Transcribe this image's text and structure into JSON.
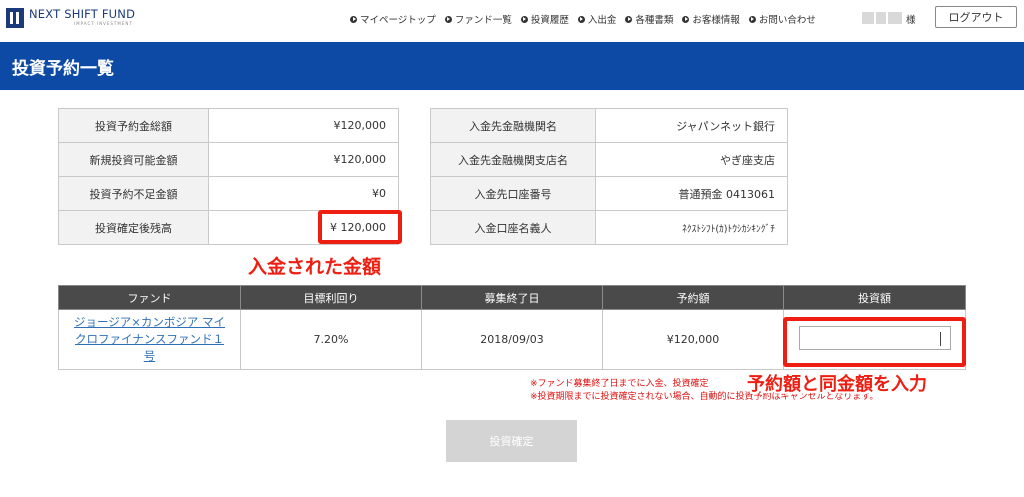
{
  "header": {
    "logo_name": "NEXT SHIFT FUND",
    "logo_sub": "IMPACT INVESTMENT",
    "nav": [
      {
        "label": "マイページトップ"
      },
      {
        "label": "ファンド一覧"
      },
      {
        "label": "投資履歴"
      },
      {
        "label": "入出金"
      },
      {
        "label": "各種書類"
      },
      {
        "label": "お客様情報"
      },
      {
        "label": "お問い合わせ"
      }
    ],
    "user_suffix": "様",
    "logout_label": "ログアウト"
  },
  "page": {
    "title": "投資予約一覧"
  },
  "summary": [
    {
      "label": "投資予約金総額",
      "value": "¥120,000"
    },
    {
      "label": "新規投資可能金額",
      "value": "¥120,000"
    },
    {
      "label": "投資予約不足金額",
      "value": "¥0"
    },
    {
      "label": "投資確定後残高",
      "value": "¥ 120,000"
    }
  ],
  "bank": [
    {
      "label": "入金先金融機関名",
      "value": "ジャパンネット銀行"
    },
    {
      "label": "入金先金融機関支店名",
      "value": "やぎ座支店"
    },
    {
      "label": "入金先口座番号",
      "value": "普通預金 0413061"
    },
    {
      "label": "入金口座名義人",
      "value": "ﾈｸｽﾄｼﾌﾄ(ｶ)ﾄｳｼｶｼｷﾝｸﾞﾁ"
    }
  ],
  "fund_table": {
    "headers": [
      "ファンド",
      "目標利回り",
      "募集終了日",
      "予約額",
      "投資額"
    ],
    "rows": [
      {
        "fund_name": "ジョージア×カンボジア マイクロファイナンスファンド１号",
        "yield": "7.20%",
        "end_date": "2018/09/03",
        "reserved": "¥120,000",
        "invest_value": ""
      }
    ]
  },
  "annotations": {
    "deposit": "入金された金額",
    "invest": "予約額と同金額を入力",
    "colors": {
      "highlight": "#ee1f12"
    }
  },
  "notes": [
    "※ファンド募集終了日までに入金、投資確定",
    "※投資期限までに投資確定されない場合、自動的に投資予約はキャンセルとなります。"
  ],
  "confirm_label": "投資確定",
  "colors": {
    "brand": "#0c4aa6",
    "table_header": "#4a4a4a",
    "link": "#2f6fb7"
  }
}
